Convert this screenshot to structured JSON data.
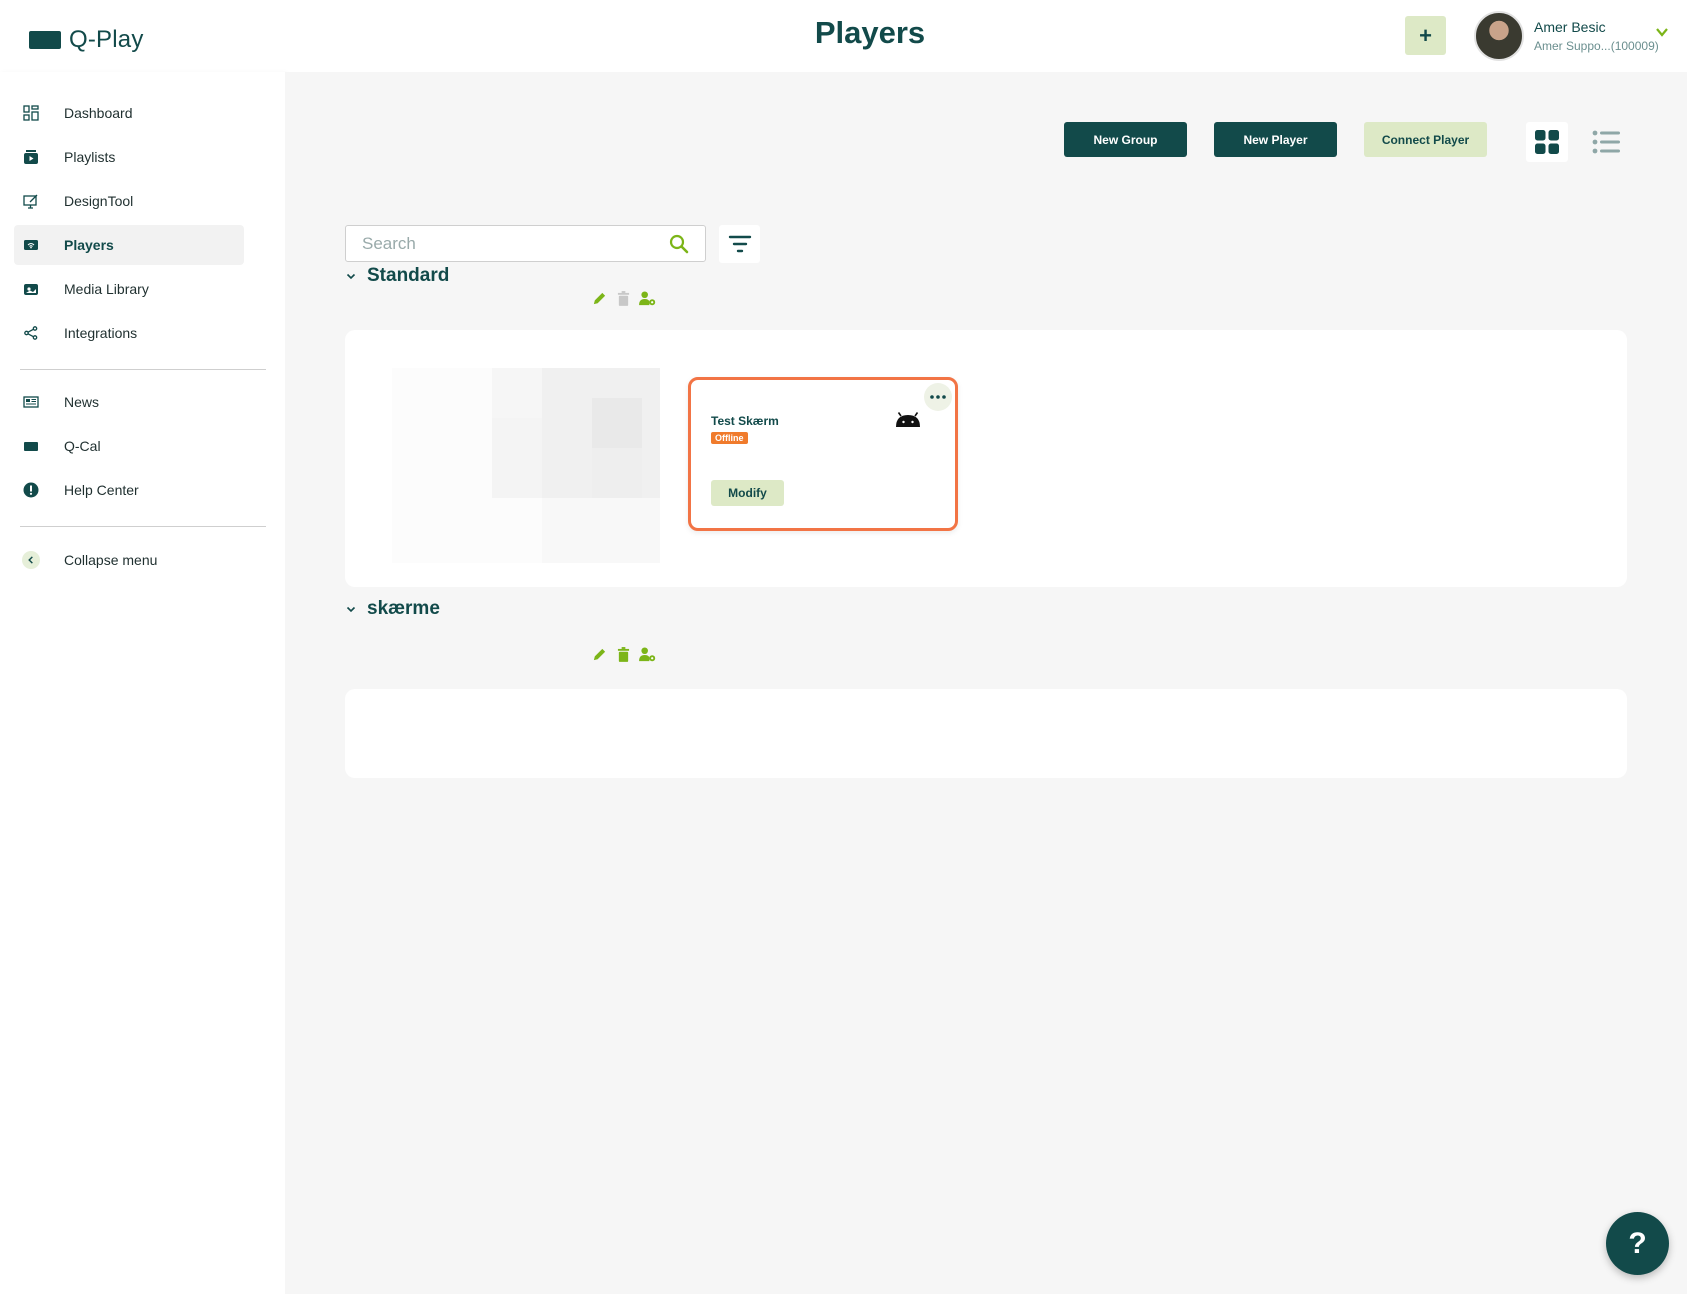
{
  "app": {
    "logo_text": "Q-Play"
  },
  "header": {
    "title": "Players",
    "plus_label": "+",
    "user_name": "Amer Besic",
    "user_sub": "Amer Suppo...(100009)"
  },
  "sidebar": {
    "items": [
      {
        "label": "Dashboard",
        "icon": "dashboard-icon"
      },
      {
        "label": "Playlists",
        "icon": "playlist-icon"
      },
      {
        "label": "DesignTool",
        "icon": "design-tool-icon"
      },
      {
        "label": "Players",
        "icon": "player-icon",
        "active": true
      },
      {
        "label": "Media Library",
        "icon": "media-library-icon"
      },
      {
        "label": "Integrations",
        "icon": "share-icon"
      }
    ],
    "secondary": [
      {
        "label": "News",
        "icon": "news-icon"
      },
      {
        "label": "Q-Cal",
        "icon": "calendar-icon"
      },
      {
        "label": "Help Center",
        "icon": "alert-circle-icon"
      }
    ],
    "collapse_label": "Collapse menu"
  },
  "toolbar": {
    "new_group": "New Group",
    "new_player": "New Player",
    "connect_player": "Connect Player"
  },
  "search": {
    "placeholder": "Search"
  },
  "groups": [
    {
      "name": "Standard",
      "players": [
        {
          "name": "Test Skærm",
          "status": "Offline",
          "platform": "android",
          "action": "Modify"
        }
      ]
    },
    {
      "name": "skærme",
      "players": []
    }
  ],
  "help_fab": "?",
  "colors": {
    "primary": "#124a4a",
    "accent_light": "#dde9c6",
    "offline": "#f07b2c",
    "highlight": "#f27445",
    "icon_green": "#7cb518"
  }
}
